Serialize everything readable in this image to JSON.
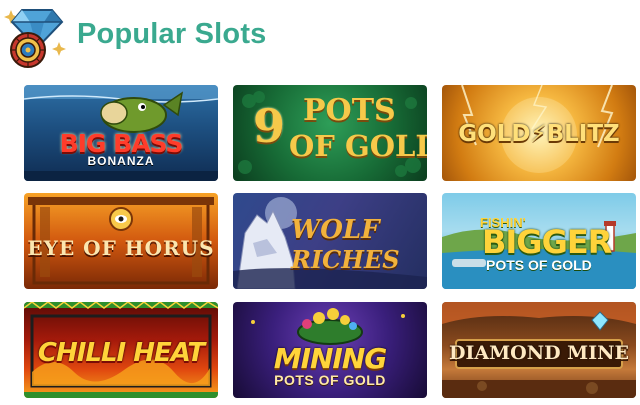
{
  "header": {
    "title": "Popular Slots",
    "icon": "diamond-roulette-icon"
  },
  "colors": {
    "title": "#3aa98f",
    "diamond": "#4fa3d8",
    "sparkle": "#e9b84c"
  },
  "slots": [
    {
      "id": "big-bass",
      "lines": [
        "BIG BASS",
        "BONANZA"
      ]
    },
    {
      "id": "9-pots",
      "lines": [
        "9",
        "POTS",
        "OF GOLD"
      ]
    },
    {
      "id": "gold-blitz",
      "lines": [
        "GOLD⚡BLITZ"
      ]
    },
    {
      "id": "eye-of-horus",
      "lines": [
        "EYE OF HORUS"
      ]
    },
    {
      "id": "wolf-riches",
      "lines": [
        "WOLF",
        "RICHES"
      ]
    },
    {
      "id": "fishin-bigger",
      "lines": [
        "FISHIN'",
        "BIGGER",
        "POTS OF GOLD"
      ]
    },
    {
      "id": "chilli-heat",
      "lines": [
        "CHILLI HEAT"
      ]
    },
    {
      "id": "mining",
      "lines": [
        "MINING",
        "POTS OF GOLD"
      ]
    },
    {
      "id": "diamond-mine",
      "lines": [
        "DIAMOND MINE"
      ]
    }
  ]
}
